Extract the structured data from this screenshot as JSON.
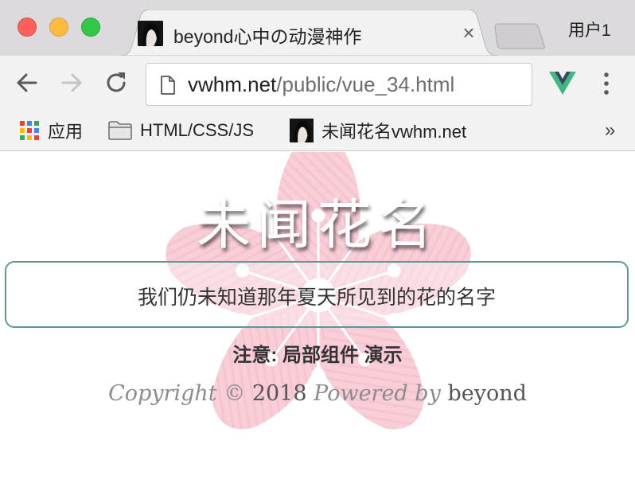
{
  "window": {
    "profile_label": "用户1"
  },
  "tab": {
    "title": "beyond心中の动漫神作",
    "close_glyph": "×"
  },
  "toolbar": {
    "url_host": "vwhm.net",
    "url_path": "/public/vue_34.html"
  },
  "bookmarks": {
    "apps_label": "应用",
    "folder_label": "HTML/CSS/JS",
    "site_label": "未闻花名vwhm.net",
    "more_glyph": "»"
  },
  "page": {
    "title": "未闻花名",
    "subtitle": "我们仍未知道那年夏天所见到的花的名字",
    "note": "注意: 局部组件 演示",
    "footer": {
      "copyright": "Copyright",
      "symbol": "©",
      "year": "2018",
      "powered": "Powered by",
      "author": "beyond"
    }
  },
  "colors": {
    "accent_border": "#5a9a96",
    "blossom": "#f8c9d4",
    "vue_green": "#41b883",
    "vue_dark": "#35495e"
  },
  "icons": {
    "apps": "apps-grid-icon",
    "folder": "folder-icon",
    "back": "arrow-left-icon",
    "forward": "arrow-right-icon",
    "reload": "reload-icon",
    "page": "page-icon",
    "vue_devtools": "vue-icon",
    "menu": "more-vertical-icon"
  }
}
